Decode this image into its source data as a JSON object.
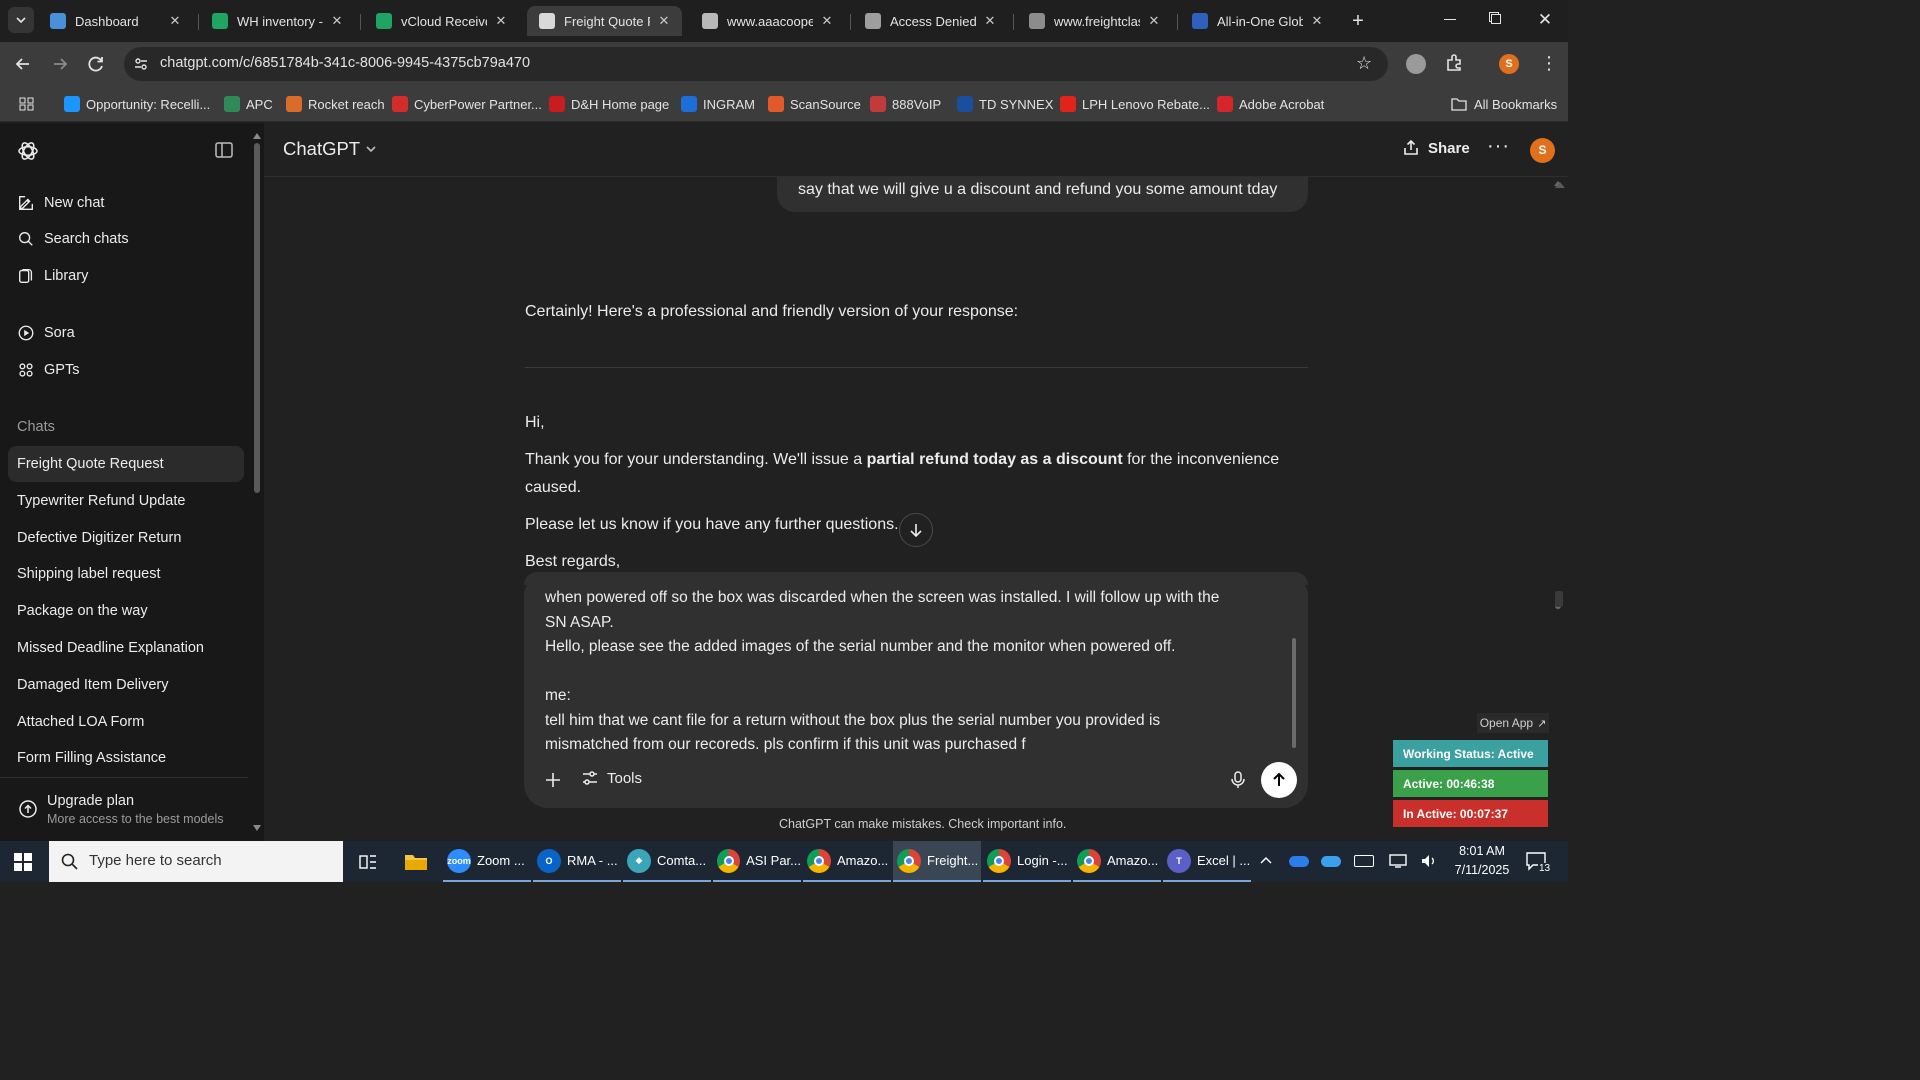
{
  "browser": {
    "tabs": [
      {
        "title": "Dashboard",
        "icon": "dashboard-tab-icon",
        "color": "#4a90d9"
      },
      {
        "title": "WH inventory - G",
        "icon": "google-sheets-icon",
        "color": "#1fa463"
      },
      {
        "title": "vCloud Receive F",
        "icon": "google-sheets-icon",
        "color": "#1fa463"
      },
      {
        "title": "Freight Quote Re",
        "icon": "chatgpt-icon",
        "color": "#d9d9d9"
      },
      {
        "title": "www.aaacooper.c",
        "icon": "aaa-cooper-icon",
        "color": "#b8b8b8"
      },
      {
        "title": "Access Denied",
        "icon": "globe-icon",
        "color": "#9e9e9e"
      },
      {
        "title": "www.freightclass",
        "icon": "freightclass-icon",
        "color": "#8c8c8c"
      },
      {
        "title": "All-in-One Globa",
        "icon": "all-in-one-icon",
        "color": "#2f5fbf"
      }
    ],
    "active_tab_index": 3,
    "url": "chatgpt.com/c/6851784b-341c-8006-9945-4375cb79a470",
    "bookmarks": [
      {
        "label": "Opportunity: Recelli...",
        "icon": "cloud-icon",
        "color": "#1b96ff"
      },
      {
        "label": "APC",
        "icon": "apc-icon",
        "color": "#2e8b57"
      },
      {
        "label": "Rocket reach",
        "icon": "rocket-icon",
        "color": "#d96b2b"
      },
      {
        "label": "CyberPower Partner...",
        "icon": "cyberpower-icon",
        "color": "#d62b2b"
      },
      {
        "label": "D&H Home page",
        "icon": "dh-icon",
        "color": "#c91c1c"
      },
      {
        "label": "INGRAM",
        "icon": "ingram-icon",
        "color": "#1d6fd8"
      },
      {
        "label": "ScanSource",
        "icon": "scansource-icon",
        "color": "#e25a2b"
      },
      {
        "label": "888VoIP",
        "icon": "voip-icon",
        "color": "#c23b3b"
      },
      {
        "label": "TD SYNNEX",
        "icon": "td-synnex-icon",
        "color": "#1a4fa0"
      },
      {
        "label": "LPH Lenovo Rebate...",
        "icon": "lenovo-icon",
        "color": "#e2231a"
      },
      {
        "label": "Adobe Acrobat",
        "icon": "acrobat-icon",
        "color": "#d4262b"
      }
    ],
    "all_bookmarks_label": "All Bookmarks"
  },
  "sidebar": {
    "nav": [
      {
        "label": "New chat",
        "icon": "new-chat-icon"
      },
      {
        "label": "Search chats",
        "icon": "search-icon"
      },
      {
        "label": "Library",
        "icon": "library-icon"
      },
      {
        "label": "Sora",
        "icon": "sora-icon"
      },
      {
        "label": "GPTs",
        "icon": "gpts-icon"
      }
    ],
    "chats_heading": "Chats",
    "chats": [
      "Freight Quote Request",
      "Typewriter Refund Update",
      "Defective Digitizer Return",
      "Shipping label request",
      "Package on the way",
      "Missed Deadline Explanation",
      "Damaged Item Delivery",
      "Attached LOA Form",
      "Form Filling Assistance"
    ],
    "upgrade_title": "Upgrade plan",
    "upgrade_subtitle": "More access to the best models"
  },
  "header": {
    "model": "ChatGPT",
    "share_label": "Share",
    "avatar_letter": "S"
  },
  "conversation": {
    "user_bubble": "say that we will give u a discount and refund you some amount tday",
    "assistant_intro": "Certainly! Here's a professional and friendly version of your response:",
    "greeting": "Hi,",
    "body_pre": "Thank you for your understanding. We'll issue a ",
    "body_bold": "partial refund today as a discount",
    "body_post": " for the inconvenience",
    "body_line2": "caused.",
    "questions": "Please let us know if you have any further questions.",
    "signoff": "Best regards,"
  },
  "composer": {
    "lines": [
      "when powered off so the box was discarded when the screen was installed. I will follow up with the",
      "SN ASAP.",
      "Hello, please see the added images of the serial number and the monitor when powered off.",
      "",
      "me:",
      "tell him that we cant file for a return without the box plus the serial number you provided is",
      "mismatched from our recoreds. pls confirm if this unit was purchased f"
    ],
    "tools_label": "Tools",
    "disclaimer": "ChatGPT can make mistakes. Check important info."
  },
  "status_widget": {
    "open_app": "Open App",
    "working_status": "Working Status: Active",
    "active_time": "Active: 00:46:38",
    "inactive_time": "In Active: 00:07:37",
    "colors": {
      "working": "#3aa0a0",
      "active": "#3aa04a",
      "inactive": "#c9302c"
    }
  },
  "taskbar": {
    "search_placeholder": "Type here to search",
    "apps": [
      {
        "label": "Zoom ...",
        "icon": "zoom-icon",
        "color": "#2d8cff",
        "short": "zoom"
      },
      {
        "label": "RMA - ...",
        "icon": "outlook-icon",
        "color": "#0a64c8",
        "short": "O"
      },
      {
        "label": "Comta...",
        "icon": "comtaco-icon",
        "color": "#3aa6b9",
        "short": "◆"
      },
      {
        "label": "ASI Par...",
        "icon": "chrome-icon",
        "color": "#db4437",
        "short": ""
      },
      {
        "label": "Amazo...",
        "icon": "chrome-icon",
        "color": "#db4437",
        "short": ""
      },
      {
        "label": "Freight...",
        "icon": "chrome-icon",
        "color": "#db4437",
        "short": ""
      },
      {
        "label": "Login -...",
        "icon": "chrome-icon",
        "color": "#db4437",
        "short": ""
      },
      {
        "label": "Amazo...",
        "icon": "chrome-icon",
        "color": "#db4437",
        "short": ""
      },
      {
        "label": "Excel | ...",
        "icon": "teams-icon",
        "color": "#5b5fc7",
        "short": "T"
      }
    ],
    "time": "8:01 AM",
    "date": "7/11/2025",
    "notification_count": "13"
  }
}
